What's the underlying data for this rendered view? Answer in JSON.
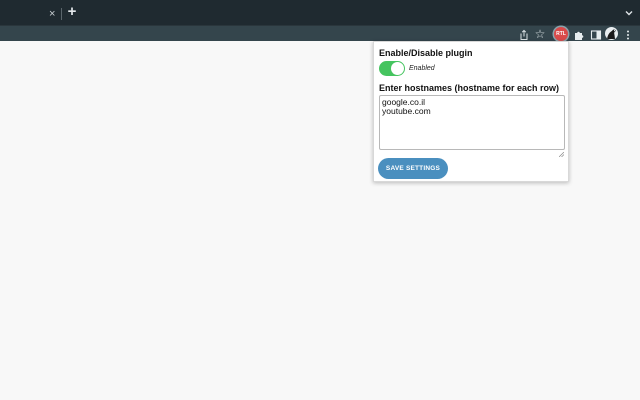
{
  "browser": {
    "tab": {
      "close_glyph": "×",
      "close_icon": "close-icon"
    },
    "new_tab_glyph": "+",
    "new_tab_icon": "plus-icon",
    "tab_menu_icon": "chevron-down-icon",
    "toolbar": {
      "icons": [
        "share-icon",
        "star-icon",
        "extension-icon",
        "puzzle-icon",
        "side-panel-icon",
        "avatar",
        "kebab-menu-icon"
      ],
      "star_glyph": "☆",
      "extension_badge": "RTL",
      "extension_color": "#d94a4a"
    }
  },
  "popup": {
    "title": "Enable/Disable plugin",
    "toggle": {
      "state": "on",
      "label": "Enabled",
      "color": "#45c45f"
    },
    "hostnames_label": "Enter hostnames (hostname for each row)",
    "hostnames_value": "google.co.il\nyoutube.com",
    "save_label": "SAVE SETTINGS",
    "save_color": "#4a8fbf"
  }
}
